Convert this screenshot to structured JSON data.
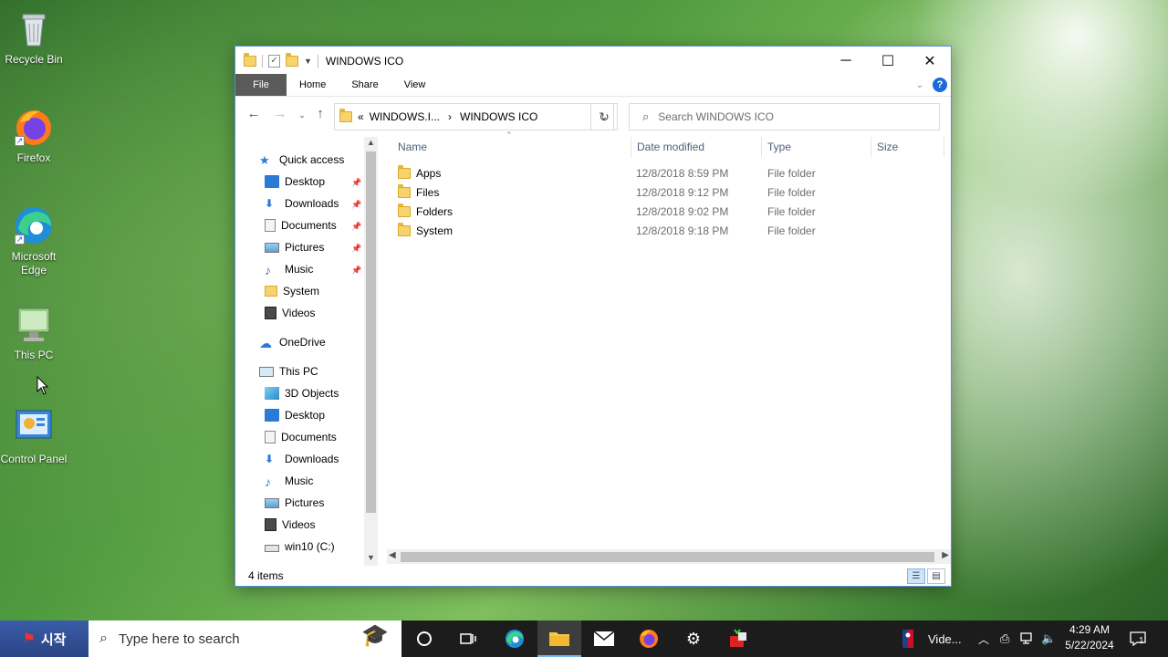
{
  "desktop": {
    "icons": [
      {
        "label": "Recycle Bin"
      },
      {
        "label": "Firefox"
      },
      {
        "label": "Microsoft Edge"
      },
      {
        "label": "This PC"
      },
      {
        "label": "Control Panel"
      }
    ]
  },
  "window": {
    "title": "WINDOWS ICO",
    "controls": {
      "minimize": "─",
      "maximize": "☐",
      "close": "✕"
    },
    "ribbon_tabs": [
      "File",
      "Home",
      "Share",
      "View"
    ],
    "address": {
      "crumb_prefix": "«",
      "parent": "WINDOWS.I...",
      "current": "WINDOWS ICO"
    },
    "search_placeholder": "Search WINDOWS ICO",
    "nav_pane": {
      "quick_access": "Quick access",
      "quick_items": [
        "Desktop",
        "Downloads",
        "Documents",
        "Pictures",
        "Music",
        "System",
        "Videos"
      ],
      "onedrive": "OneDrive",
      "this_pc": "This PC",
      "pc_items": [
        "3D Objects",
        "Desktop",
        "Documents",
        "Downloads",
        "Music",
        "Pictures",
        "Videos",
        "win10 (C:)"
      ]
    },
    "columns": {
      "name": "Name",
      "date": "Date modified",
      "type": "Type",
      "size": "Size"
    },
    "files": [
      {
        "name": "Apps",
        "date": "12/8/2018 8:59 PM",
        "type": "File folder"
      },
      {
        "name": "Files",
        "date": "12/8/2018 9:12 PM",
        "type": "File folder"
      },
      {
        "name": "Folders",
        "date": "12/8/2018 9:02 PM",
        "type": "File folder"
      },
      {
        "name": "System",
        "date": "12/8/2018 9:18 PM",
        "type": "File folder"
      }
    ],
    "status": "4 items"
  },
  "taskbar": {
    "start_label": "시작",
    "search_placeholder": "Type here to search",
    "tray_app_label": "Vide...",
    "time": "4:29 AM",
    "date": "5/22/2024",
    "notification_count": "1"
  },
  "colors": {
    "accent": "#1b6ad8",
    "folder": "#f7d36b",
    "taskbar": "#1c1c1c"
  }
}
